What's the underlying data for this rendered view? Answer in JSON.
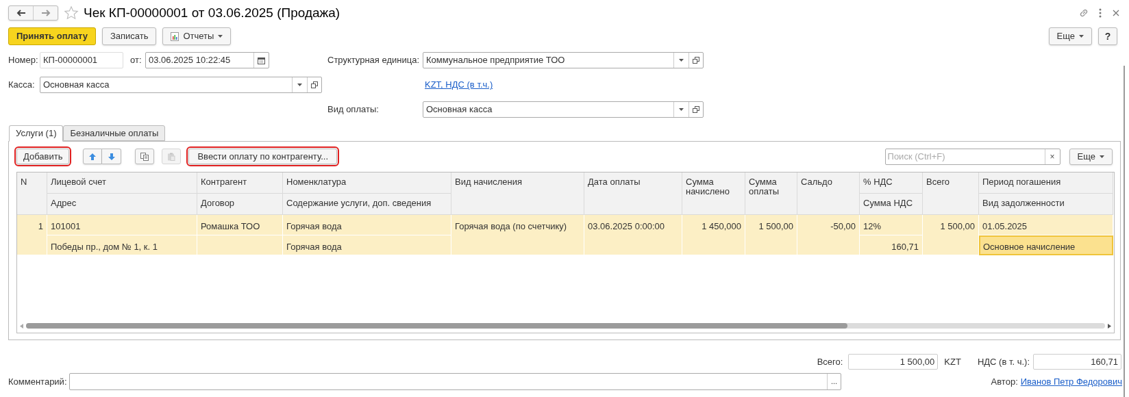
{
  "window": {
    "title": "Чек КП-00000001 от 03.06.2025 (Продажа)",
    "favorite": false
  },
  "toolbar": {
    "buttons": [
      {
        "label": "Принять оплату",
        "kind": "primary"
      },
      {
        "label": "Записать",
        "kind": "plain"
      },
      {
        "label": "Отчеты",
        "kind": "menu"
      }
    ],
    "more": "Еще",
    "help": "?"
  },
  "number": {
    "label": "Номер:",
    "value": "КП-00000001"
  },
  "date": {
    "label": "от:",
    "value": "03.06.2025 10:22:45"
  },
  "cash_desk": {
    "label": "Касса:",
    "value": "Основная касса"
  },
  "unit": {
    "label": "Структурная единица:",
    "value": "Коммунальное предприятие ТОО"
  },
  "currency_link": "KZT, НДС (в т.ч.)",
  "payment_type": {
    "label": "Вид оплаты:",
    "value": "Основная касса"
  },
  "tabs": [
    {
      "label": "Услуги (1)",
      "selected": true
    },
    {
      "label": "Безналичные оплаты",
      "selected": false
    }
  ],
  "table_toolbar": {
    "add": {
      "label": "Добавить",
      "highlighted": true
    },
    "icon_buttons": [
      {
        "kind": "up",
        "disabled": false
      },
      {
        "kind": "down",
        "disabled": false
      },
      {
        "kind": "copy",
        "disabled": false
      },
      {
        "kind": "paste",
        "disabled": true
      }
    ],
    "pay_by_counterparty": {
      "label": "Ввести оплату по контрагенту...",
      "highlighted": true
    },
    "search": {
      "placeholder": "Поиск (Ctrl+F)",
      "clear": "×"
    },
    "more": "Еще"
  },
  "table": {
    "columns": [
      {
        "title": "N"
      },
      {
        "title": "Лицевой счет",
        "subtitle": "Адрес"
      },
      {
        "title": "Контрагент",
        "subtitle": "Договор"
      },
      {
        "title": "Номенклатура",
        "subtitle": "Содержание услуги, доп. сведения"
      },
      {
        "title": "Вид начисления"
      },
      {
        "title": "Дата оплаты"
      },
      {
        "title": "Сумма начислено"
      },
      {
        "title": "Сумма оплаты"
      },
      {
        "title": "Сальдо"
      },
      {
        "title": "% НДС",
        "subtitle": "Сумма НДС"
      },
      {
        "title": "Всего"
      },
      {
        "title": "Период погашения",
        "subtitle": "Вид задолженности"
      }
    ],
    "rows": [
      {
        "selected": true,
        "cells": [
          {
            "text": "1",
            "focused": false
          },
          {
            "text": "101001",
            "text2": "Победы пр., дом № 1, к. 1",
            "focused": false
          },
          {
            "text": "Ромашка ТОО",
            "focused": false
          },
          {
            "text": "Горячая вода",
            "text2": "Горячая вода",
            "focused": false
          },
          {
            "text": "Горячая вода (по счетчику)",
            "focused": false
          },
          {
            "text": "03.06.2025 0:00:00",
            "focused": false
          },
          {
            "text": "1 450,000",
            "focused": false
          },
          {
            "text": "1 500,00",
            "focused": false
          },
          {
            "text": "-50,00",
            "focused": false
          },
          {
            "text": "12%",
            "text2": "160,71",
            "focused": false
          },
          {
            "text": "1 500,00",
            "focused": false
          },
          {
            "text": "01.05.2025",
            "text2": "Основное начисление",
            "focused": true
          }
        ]
      }
    ]
  },
  "totals": {
    "total": {
      "label": "Всего:",
      "value": "1 500,00"
    },
    "currency": "KZT",
    "vat": {
      "label": "НДС (в т. ч.):",
      "value": "160,71"
    }
  },
  "comment": {
    "label": "Комментарий:",
    "button": "..."
  },
  "author": {
    "label": "Автор:",
    "link": "Иванов Петр Федорович"
  }
}
